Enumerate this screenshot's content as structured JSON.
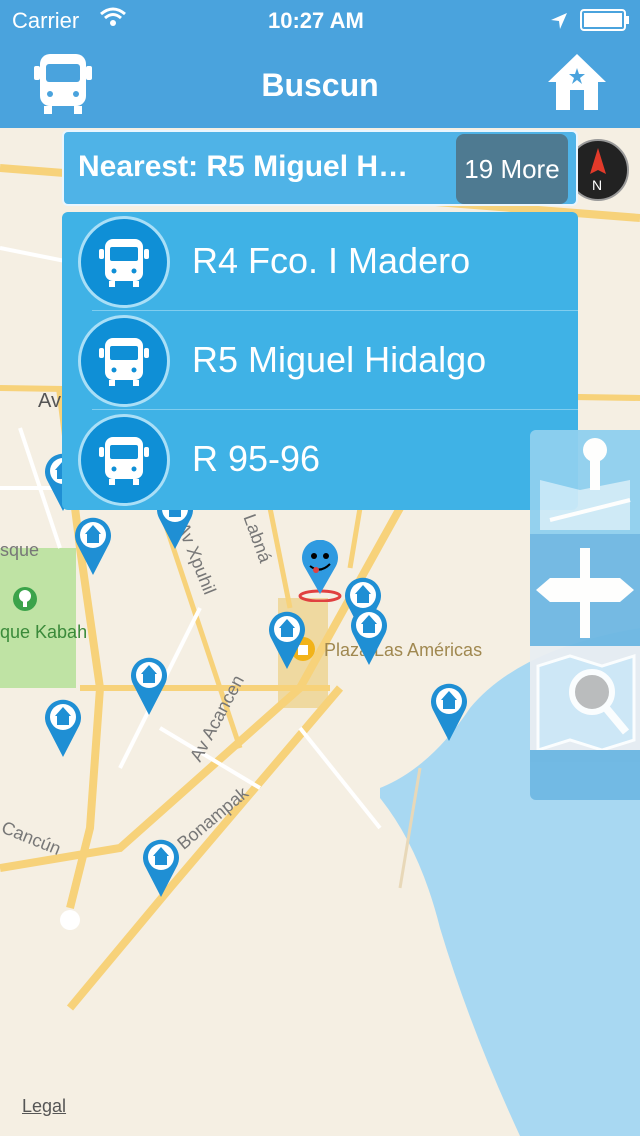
{
  "status": {
    "carrier": "Carrier",
    "time": "10:27 AM"
  },
  "header": {
    "title": "Buscun"
  },
  "nearest": {
    "label": "Nearest: R5 Miguel H…",
    "more_label": "19 More"
  },
  "routes": [
    {
      "label": "R4 Fco. I Madero"
    },
    {
      "label": "R5 Miguel Hidalgo"
    },
    {
      "label": "R 95-96"
    }
  ],
  "map": {
    "labels": {
      "plaza": "Plaza Las Américas",
      "park": "que Kabah",
      "park2": "sque",
      "av_xpuhil": "Av Xpuhil",
      "labna": "Labná",
      "av_acancen": "Av Acancen",
      "bonampak": "Bonampak",
      "cancun": "Cancún",
      "av": "Av",
      "legal": "Legal"
    }
  },
  "colors": {
    "header": "#4aa3dd",
    "panel": "#3fb2e6",
    "more": "#4e7a91",
    "map": "#f5efe3",
    "water": "#a8d8f2"
  }
}
